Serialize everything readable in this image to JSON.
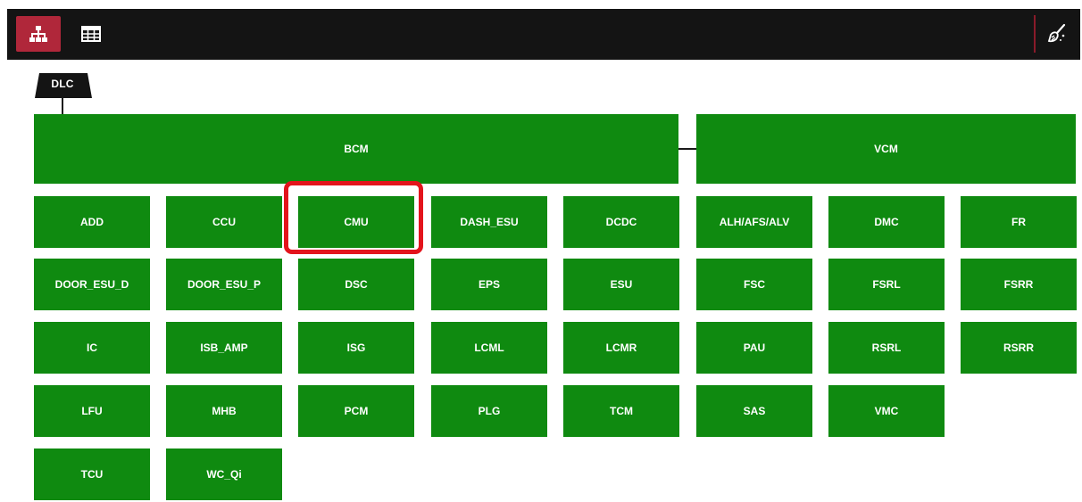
{
  "toolbar": {
    "tree_view_icon": "hierarchy-icon",
    "table_view_icon": "table-icon",
    "clean_icon": "broom-icon",
    "accent": "#b0273a",
    "background": "#141414"
  },
  "root": {
    "label": "DLC"
  },
  "gateways": {
    "bcm": "BCM",
    "vcm": "VCM"
  },
  "modules": [
    "ADD",
    "CCU",
    "CMU",
    "DASH_ESU",
    "DCDC",
    "ALH/AFS/ALV",
    "DMC",
    "FR",
    "DOOR_ESU_D",
    "DOOR_ESU_P",
    "DSC",
    "EPS",
    "ESU",
    "FSC",
    "FSRL",
    "FSRR",
    "IC",
    "ISB_AMP",
    "ISG",
    "LCML",
    "LCMR",
    "PAU",
    "RSRL",
    "RSRR",
    "LFU",
    "MHB",
    "PCM",
    "PLG",
    "TCM",
    "SAS",
    "VMC",
    "TCU",
    "WC_Qi"
  ],
  "colors": {
    "module_green": "#0f8a10",
    "highlight_red": "#e3141c"
  }
}
